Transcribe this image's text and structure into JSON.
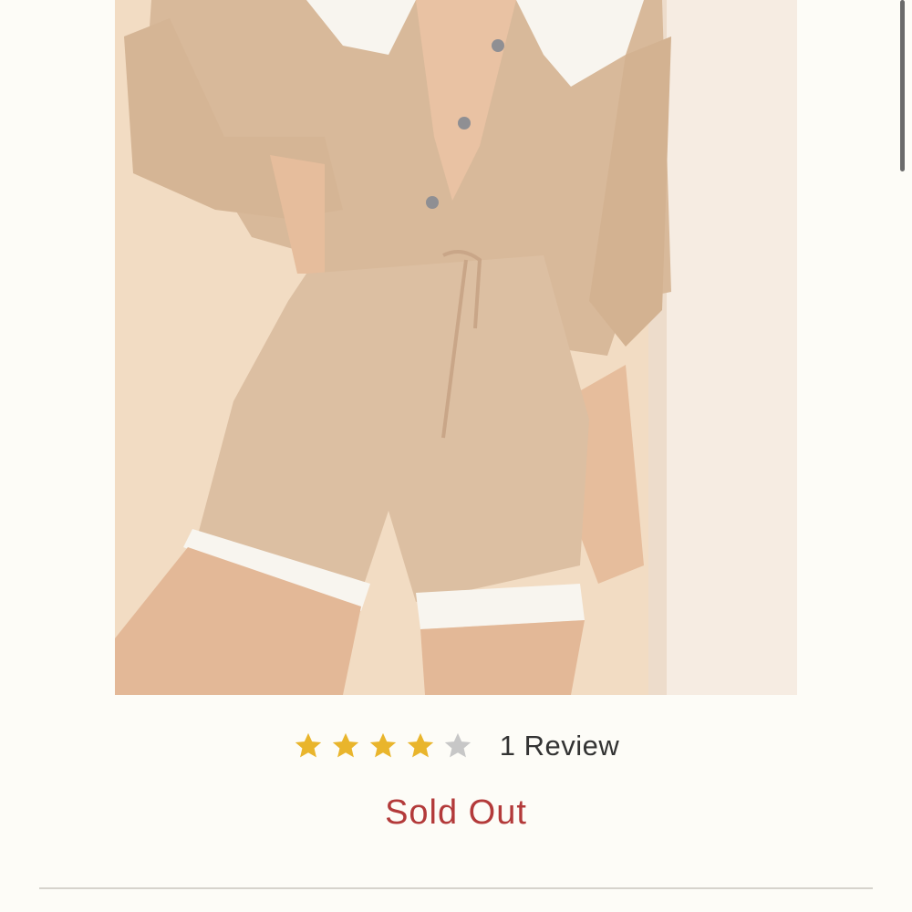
{
  "product": {
    "image_alt": "Model wearing a beige knit cardigan with white ruffle collar and matching knit shorts with white ruffle hems"
  },
  "rating": {
    "value": 4,
    "max": 5,
    "review_label": "1 Review"
  },
  "status": {
    "sold_out_label": "Sold Out"
  },
  "colors": {
    "background": "#fdfcf7",
    "star_filled": "#e9b52c",
    "star_empty": "#c7c7c7",
    "sold_out_text": "#b33a3a",
    "review_text": "#333333",
    "divider": "#d6d3cc"
  },
  "icons": {
    "star_filled": "star-filled-icon",
    "star_empty": "star-empty-icon"
  }
}
